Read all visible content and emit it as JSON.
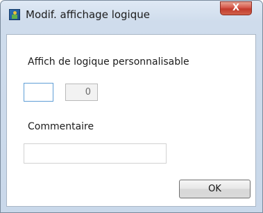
{
  "window": {
    "title": "Modif. affichage logique",
    "close_label": "X",
    "app_icon": "application-icon"
  },
  "form": {
    "custom_logic_label": "Affich de logique personnalisable",
    "custom_logic_value": "",
    "custom_logic_readonly_value": "0",
    "comment_label": "Commentaire",
    "comment_value": ""
  },
  "buttons": {
    "ok_label": "OK"
  },
  "colors": {
    "focus_border": "#5f9ed6",
    "close_button": "#c23a2c"
  }
}
